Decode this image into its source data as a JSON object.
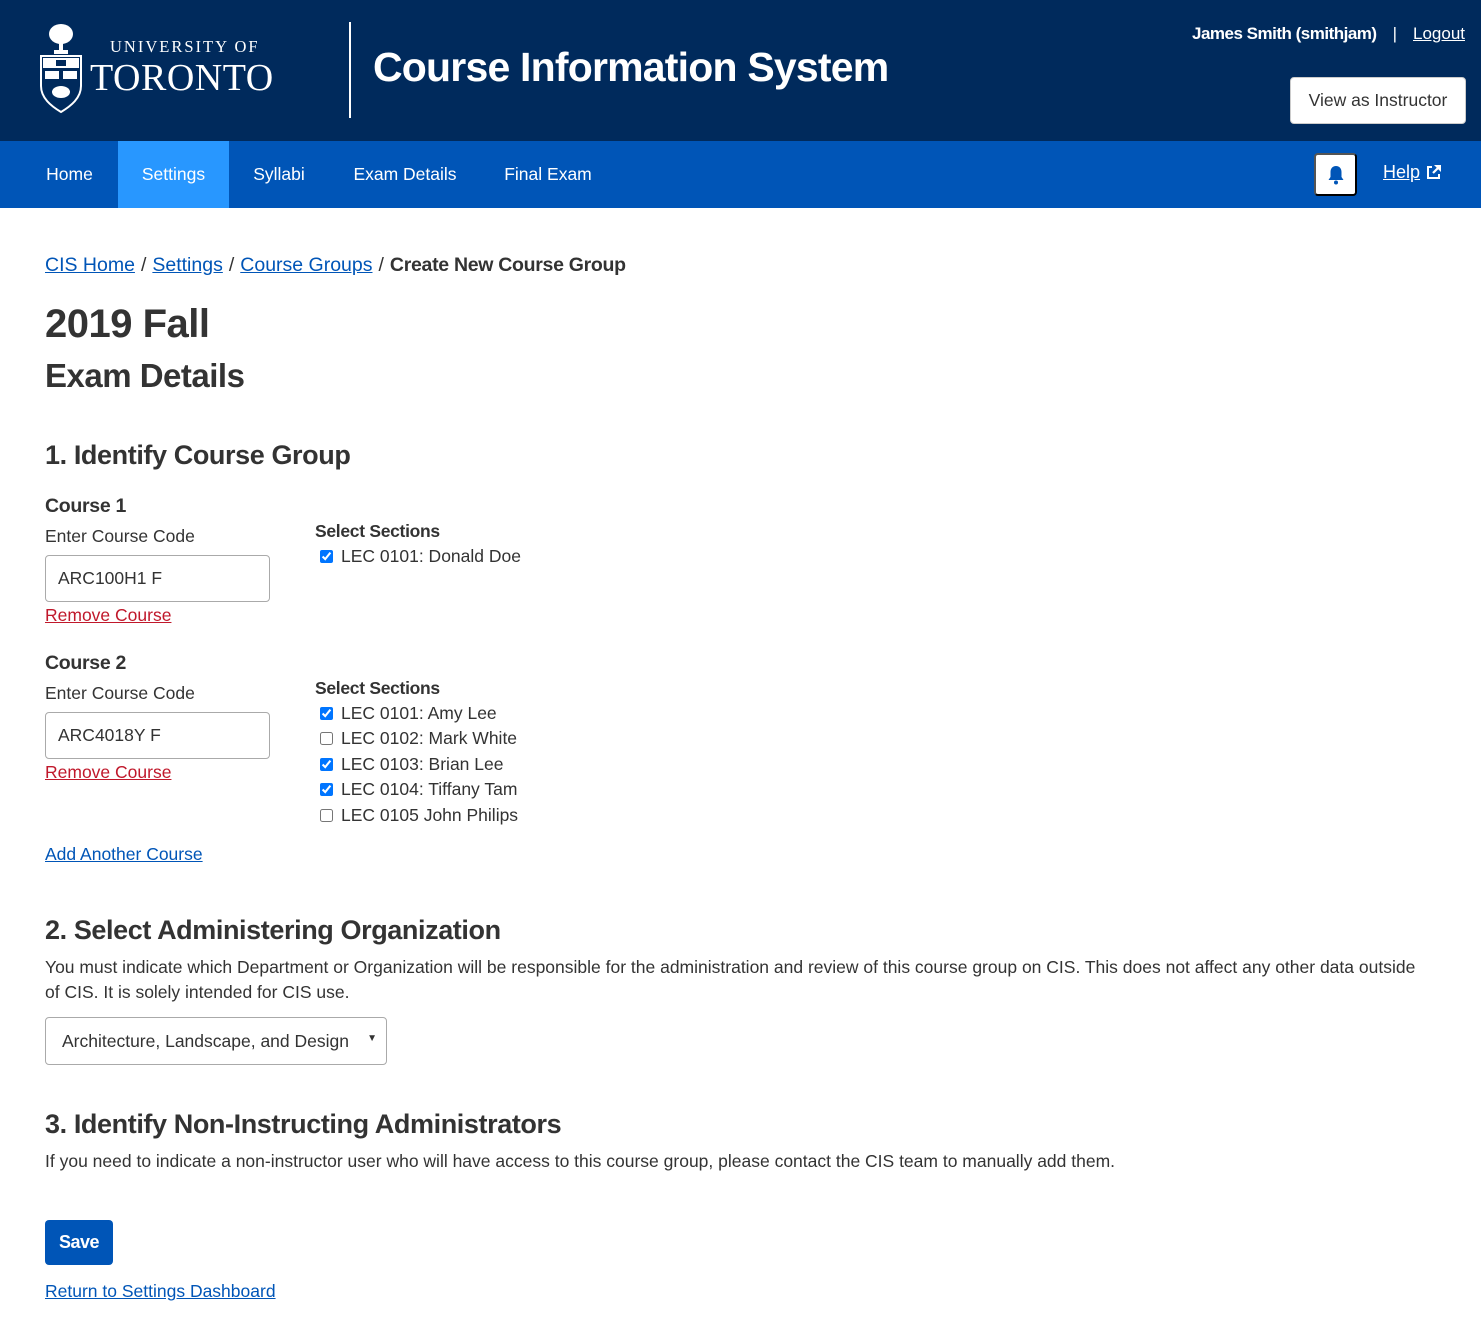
{
  "header": {
    "logo": {
      "line1": "UNIVERSITY OF",
      "line2": "TORONTO"
    },
    "app_title": "Course Information System",
    "user_name": "James Smith (smithjam)",
    "separator": "|",
    "logout_label": "Logout",
    "view_as_label": "View as Instructor"
  },
  "nav": {
    "items": [
      {
        "label": "Home",
        "active": false
      },
      {
        "label": "Settings",
        "active": true
      },
      {
        "label": "Syllabi",
        "active": false
      },
      {
        "label": "Exam Details",
        "active": false
      },
      {
        "label": "Final Exam",
        "active": false
      }
    ],
    "bell_icon": "bell-icon",
    "help_label": "Help",
    "help_icon": "external-link-icon"
  },
  "breadcrumb": {
    "items": [
      {
        "label": "CIS Home",
        "link": true
      },
      {
        "label": "Settings",
        "link": true
      },
      {
        "label": "Course Groups",
        "link": true
      },
      {
        "label": "Create New Course Group",
        "link": false
      }
    ],
    "separator": "/"
  },
  "page": {
    "term": "2019 Fall",
    "subtitle": "Exam Details"
  },
  "section1": {
    "title": "1. Identify Course Group",
    "courses": [
      {
        "label": "Course 1",
        "code_label": "Enter Course Code",
        "code_value": "ARC100H1 F",
        "remove_label": "Remove Course",
        "sections_label": "Select Sections",
        "sections": [
          {
            "label": "LEC 0101: Donald Doe",
            "checked": true
          }
        ]
      },
      {
        "label": "Course 2",
        "code_label": "Enter Course Code",
        "code_value": "ARC4018Y F",
        "remove_label": "Remove Course",
        "sections_label": "Select Sections",
        "sections": [
          {
            "label": "LEC 0101: Amy Lee",
            "checked": true
          },
          {
            "label": "LEC 0102: Mark White",
            "checked": false
          },
          {
            "label": "LEC 0103: Brian Lee",
            "checked": true
          },
          {
            "label": "LEC 0104: Tiffany Tam",
            "checked": true
          },
          {
            "label": "LEC 0105 John Philips",
            "checked": false
          }
        ]
      }
    ],
    "add_course_label": "Add Another Course"
  },
  "section2": {
    "title": "2. Select Administering Organization",
    "description": "You must indicate which Department or Organization will be responsible for the administration and review of this course group on CIS. This does not affect any other data outside of CIS. It is solely intended for CIS use.",
    "selected_org": "Architecture, Landscape, and Design"
  },
  "section3": {
    "title": "3. Identify Non-Instructing Administrators",
    "description": "If you need to indicate a non-instructor user who will have access to this course group, please contact the CIS team to manually add them."
  },
  "actions": {
    "save_label": "Save",
    "return_label": "Return to Settings Dashboard"
  },
  "colors": {
    "header_bg": "#002a5c",
    "nav_bg": "#0055b7",
    "nav_active": "#2897ff",
    "link": "#0055b7",
    "danger_link": "#c0182b"
  }
}
